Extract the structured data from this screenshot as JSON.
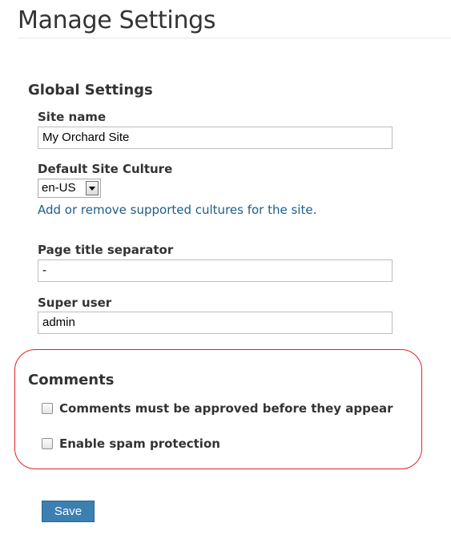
{
  "page": {
    "title": "Manage Settings"
  },
  "global_settings": {
    "heading": "Global Settings",
    "site_name": {
      "label": "Site name",
      "value": "My Orchard Site"
    },
    "culture": {
      "label": "Default Site Culture",
      "selected": "en-US",
      "link_text": "Add or remove supported cultures for the site."
    },
    "separator": {
      "label": "Page title separator",
      "value": "-"
    },
    "super_user": {
      "label": "Super user",
      "value": "admin"
    }
  },
  "comments": {
    "heading": "Comments",
    "approve_label": "Comments must be approved before they appear",
    "approve_checked": false,
    "spam_label": "Enable spam protection",
    "spam_checked": false
  },
  "actions": {
    "save_label": "Save"
  },
  "colors": {
    "link": "#1e5d87",
    "highlight": "#e0202a",
    "button": "#3c7fb1"
  }
}
